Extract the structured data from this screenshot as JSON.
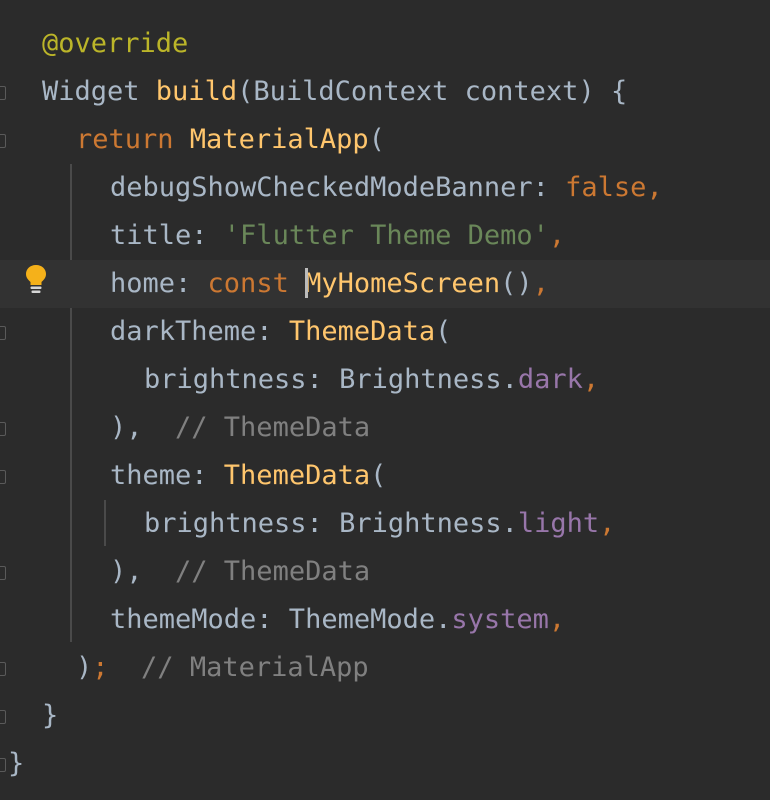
{
  "editor": {
    "theme_colors": {
      "background": "#2b2b2b",
      "current_line": "#323232",
      "keyword": "#cc7832",
      "function": "#ffc66d",
      "string": "#6a8759",
      "field": "#9876aa",
      "comment": "#808080",
      "annotation": "#bbb529",
      "text": "#a9b7c6"
    },
    "lines": [
      {
        "tokens": [
          {
            "t": "@override",
            "k": "annotation"
          }
        ]
      },
      {
        "tokens": [
          {
            "t": "Widget ",
            "k": "plain"
          },
          {
            "t": "build",
            "k": "func"
          },
          {
            "t": "(BuildContext context) {",
            "k": "plain"
          }
        ]
      },
      {
        "tokens": [
          {
            "t": "return ",
            "k": "keyword"
          },
          {
            "t": "MaterialApp",
            "k": "ctor"
          },
          {
            "t": "(",
            "k": "plain"
          }
        ]
      },
      {
        "tokens": [
          {
            "t": "debugShowCheckedModeBanner: ",
            "k": "plain"
          },
          {
            "t": "false",
            "k": "keyword"
          },
          {
            "t": ",",
            "k": "keyword"
          }
        ]
      },
      {
        "tokens": [
          {
            "t": "title: ",
            "k": "plain"
          },
          {
            "t": "'Flutter Theme Demo'",
            "k": "string"
          },
          {
            "t": ",",
            "k": "keyword"
          }
        ]
      },
      {
        "tokens": [
          {
            "t": "home: ",
            "k": "plain"
          },
          {
            "t": "const ",
            "k": "keyword"
          },
          {
            "t": "MyHomeScreen",
            "k": "ctor"
          },
          {
            "t": "()",
            "k": "plain"
          },
          {
            "t": ",",
            "k": "keyword"
          }
        ]
      },
      {
        "tokens": [
          {
            "t": "darkTheme: ",
            "k": "plain"
          },
          {
            "t": "ThemeData",
            "k": "ctor"
          },
          {
            "t": "(",
            "k": "plain"
          }
        ]
      },
      {
        "tokens": [
          {
            "t": "brightness: Brightness.",
            "k": "plain"
          },
          {
            "t": "dark",
            "k": "field"
          },
          {
            "t": ",",
            "k": "keyword"
          }
        ]
      },
      {
        "tokens": [
          {
            "t": "),  ",
            "k": "plain"
          },
          {
            "t": "// ThemeData",
            "k": "comment"
          }
        ]
      },
      {
        "tokens": [
          {
            "t": "theme: ",
            "k": "plain"
          },
          {
            "t": "ThemeData",
            "k": "ctor"
          },
          {
            "t": "(",
            "k": "plain"
          }
        ]
      },
      {
        "tokens": [
          {
            "t": "brightness: Brightness.",
            "k": "plain"
          },
          {
            "t": "light",
            "k": "field"
          },
          {
            "t": ",",
            "k": "keyword"
          }
        ]
      },
      {
        "tokens": [
          {
            "t": "),  ",
            "k": "plain"
          },
          {
            "t": "// ThemeData",
            "k": "comment"
          }
        ]
      },
      {
        "tokens": [
          {
            "t": "themeMode: ThemeMode.",
            "k": "plain"
          },
          {
            "t": "system",
            "k": "field"
          },
          {
            "t": ",",
            "k": "keyword"
          }
        ]
      },
      {
        "tokens": [
          {
            "t": ")",
            "k": "plain"
          },
          {
            "t": ";",
            "k": "keyword"
          },
          {
            "t": "  ",
            "k": "plain"
          },
          {
            "t": "// MaterialApp",
            "k": "comment"
          }
        ]
      },
      {
        "tokens": [
          {
            "t": "}",
            "k": "plain"
          }
        ]
      },
      {
        "tokens": [
          {
            "t": "}",
            "k": "plain"
          }
        ]
      }
    ],
    "intention_icon": "lightbulb-icon"
  }
}
